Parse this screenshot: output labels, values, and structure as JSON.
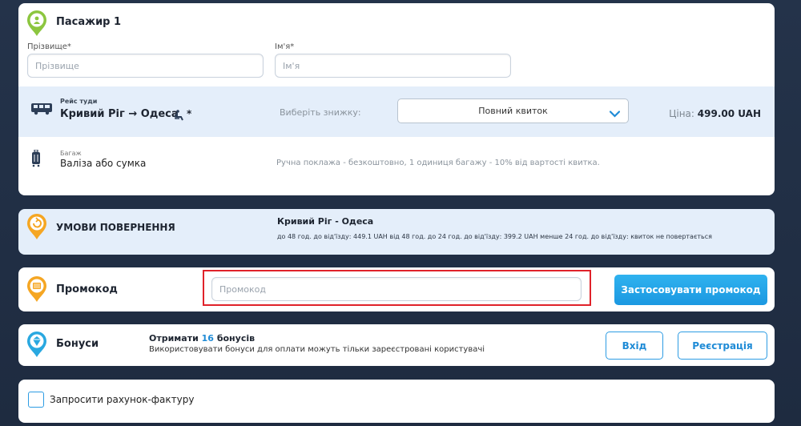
{
  "passenger": {
    "title": "Пасажир 1",
    "surname_label": "Прізвище*",
    "surname_placeholder": "Прізвище",
    "name_label": "Ім'я*",
    "name_placeholder": "Ім'я"
  },
  "trip": {
    "direction_label": "Рейс туди",
    "route": "Кривий Ріг",
    "route_arrow": "→",
    "route_to": "Одеса",
    "seat_mark": "*",
    "discount_label": "Виберіть знижку:",
    "discount_value": "Повний квиток",
    "price_label": "Ціна:",
    "price_value": "499.00 UAH"
  },
  "baggage": {
    "label": "Багаж",
    "value": "Валіза або сумка",
    "note": "Ручна поклажа - безкоштовно, 1 одиниця багажу - 10% від вартості квитка."
  },
  "refund": {
    "title": "УМОВИ ПОВЕРНЕННЯ",
    "route": "Кривий Ріг - Одеса",
    "conditions": "до 48 год. до від'їзду: 449.1 UAH від 48 год. до 24 год. до від'їзду: 399.2 UAH менше 24 год. до від'їзду: квиток не повертається"
  },
  "promo": {
    "title": "Промокод",
    "placeholder": "Промокод",
    "apply_button": "Застосовувати промокод"
  },
  "bonus": {
    "title": "Бонуси",
    "get_prefix": "Отримати",
    "count": "16",
    "get_suffix": "бонусів",
    "note": "Використовувати бонуси для оплати можуть тільки зареєстровані користувачі",
    "login_button": "Вхід",
    "register_button": "Реєстрація"
  },
  "invoice": {
    "label": "Запросити рахунок-фактуру"
  },
  "colors": {
    "accent_blue": "#1b98e1",
    "highlight_red": "#e0222a",
    "green_pin": "#8cc63f",
    "orange_pin": "#f5a623",
    "blue_pin": "#29a8e0"
  },
  "icons": {
    "passenger": "user-pin-icon",
    "bus": "bus-icon",
    "seat": "seat-icon",
    "suitcase": "suitcase-icon",
    "refund": "refund-pin-icon",
    "promo": "promo-pin-icon",
    "bonus": "bonus-pin-icon",
    "dropdown": "chevron-down-icon"
  }
}
